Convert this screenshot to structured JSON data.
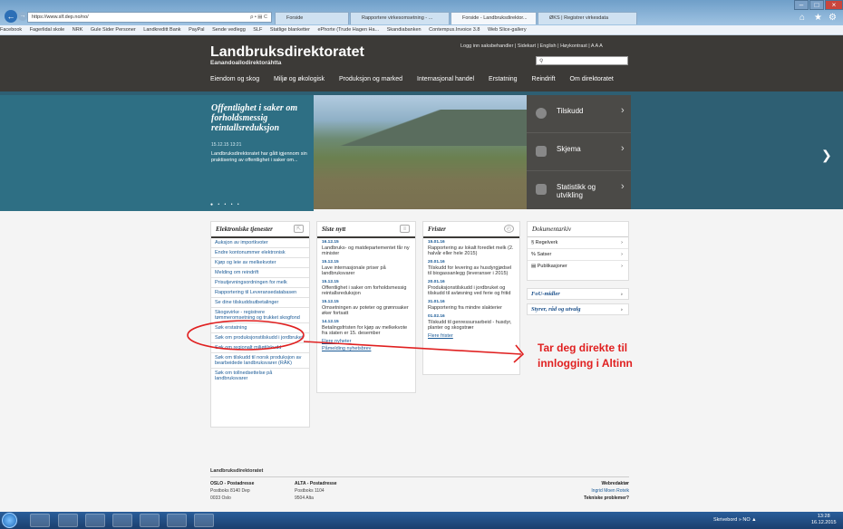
{
  "browser": {
    "address": "https://www.slf.dep.no/no/",
    "address_icons": "ρ • ▤ C",
    "tabs": [
      "Forside",
      "Rapportere virkesomsetning - ...",
      "Forside - Landbruksdirektor...",
      "ØKS | Registrer virkesdata"
    ],
    "favorites": [
      "Facebook",
      "Fagerlidal skole",
      "NRK",
      "Gule Sider Personer",
      "Landkreditt Bank",
      "PayPal",
      "Sende vedlegg",
      "SLF",
      "Statlige blanketter",
      "ePhorte (Trude Hagen Ha...",
      "Skandiabanken",
      "Contempus.Invoice 3.8",
      "Web Slice-gallery"
    ]
  },
  "header": {
    "title": "Landbruksdirektoratet",
    "subtitle": "Eanandoallodirektoráhtta",
    "toplinks": "Logg inn saksbehandler  |  Sidekart  |  English  |     Høykontrast  |  A A A",
    "menu": [
      "Eiendom og skog",
      "Miljø og økologisk",
      "Produksjon og marked",
      "Internasjonal handel",
      "Erstatning",
      "Reindrift",
      "Om direktoratet"
    ]
  },
  "hero": {
    "heading": "Offentlighet i saker om forholdsmessig reintallsreduksjon",
    "date": "15.12.15 13:21",
    "body": "Landbruksdirektoratet har gått igjennom sin praktisering av offentlighet i saker om...",
    "dots": "● • • • •",
    "quicklinks": [
      "Tilskudd",
      "Skjema",
      "Statistikk og utvikling"
    ]
  },
  "eservices": {
    "title": "Elektroniske tjenester",
    "items": [
      "Auksjon av importkvoter",
      "Endre kontonummer elektronisk",
      "Kjøp og leie av melkekvoter",
      "Melding om reindrift",
      "Prisutjevningsordningen for melk",
      "Rapportering til Leveransedatabasen",
      "Se dine tilskuddsutbetalinger",
      "Skogsvirke - registrere tømmeromsetning og trukket skogfond",
      "Søk erstatning",
      "Søk om produksjonstilskudd i jordbruket",
      "Søk om regionalt miljøtilskudd",
      "Søk om tilskudd til norsk produksjon av bearbeidede landbruksvarer (RÅK)",
      "Søk om tollnedsettelse på landbruksvarer"
    ]
  },
  "news": {
    "title": "Siste nytt",
    "items": [
      {
        "date": "16.12.15",
        "text": "Landbruks- og matdepartementet får ny minister"
      },
      {
        "date": "15.12.15",
        "text": "Lave internasjonale priser på landbruksvarer"
      },
      {
        "date": "15.12.15",
        "text": "Offentlighet i saker om forholdsmessig reintallsreduksjon"
      },
      {
        "date": "15.12.15",
        "text": "Omsetningen av poteter og grønnsaker øker fortsatt"
      },
      {
        "date": "14.12.15",
        "text": "Betalingsfristen for kjøp av melkekvote fra staten er 15. desember"
      }
    ],
    "links": [
      "Flere nyheter",
      "Påmelding nyhetsbrev"
    ]
  },
  "deadlines": {
    "title": "Frister",
    "items": [
      {
        "date": "15.01.16",
        "text": "Rapportering av lokalt foredlet melk (2. halvår eller hele 2015)"
      },
      {
        "date": "20.01.16",
        "text": "Tilskudd for levering av husdyrgjødsel til biogassanlegg (leveranser i 2015)"
      },
      {
        "date": "20.01.16",
        "text": "Produksjonstilskudd i jordbruket og tilskudd til avløsning ved ferie og fritid"
      },
      {
        "date": "31.01.16",
        "text": "Rapportering fra mindre slakterier"
      },
      {
        "date": "01.02.16",
        "text": "Tilskudd til genressursarbeid - husdyr, planter og skogstrær"
      }
    ],
    "more": "Flere frister"
  },
  "documents": {
    "title": "Dokumentarkiv",
    "items": [
      "Regelverk",
      "Satser",
      "Publikasjoner"
    ],
    "boxes": [
      "FoU-midler",
      "Styrer, råd og utvalg"
    ]
  },
  "annotation": "Tar deg direkte til innlogging i Altinn",
  "footer": {
    "name": "Landbruksdirektoratet",
    "col1": [
      "OSLO - Postadresse",
      "Postboks 8140 Dep",
      "0033 Oslo"
    ],
    "col2": [
      "ALTA - Postadresse",
      "Postboks 1104",
      "9504 Alta"
    ],
    "col3": [
      "Webredaktør",
      "Ingrid Moen Rotvik",
      "Tekniske problemer?"
    ]
  },
  "taskbar": {
    "tray": "Skrivebord  »  NO  ▲",
    "time": "13:28",
    "date": "16.12.2015"
  },
  "colors": {
    "header": "#3c3a37",
    "hero": "#2e6f84",
    "link": "#1a5a96",
    "annotation": "#e02020"
  }
}
